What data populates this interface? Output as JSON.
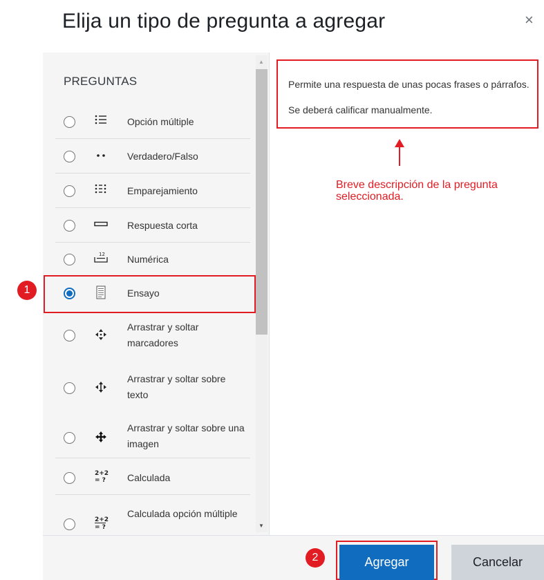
{
  "dialog": {
    "title": "Elija un tipo de pregunta a agregar",
    "close_symbol": "×"
  },
  "left_pane": {
    "section_label": "PREGUNTAS",
    "items": [
      {
        "name": "opcion-multiple",
        "label": "Opción múltiple",
        "icon": "list-icon",
        "glyph": "⁝☰",
        "checked": false
      },
      {
        "name": "verdadero-falso",
        "label": "Verdadero/Falso",
        "icon": "two-dots-icon",
        "glyph": "• •",
        "checked": false
      },
      {
        "name": "emparejamiento",
        "label": "Emparejamiento",
        "icon": "matching-icon",
        "glyph": "⁝⁝",
        "checked": false
      },
      {
        "name": "respuesta-corta",
        "label": "Respuesta corta",
        "icon": "short-answer-icon",
        "glyph": "▭",
        "checked": false
      },
      {
        "name": "numerica",
        "label": "Numérica",
        "icon": "numeric-icon",
        "glyph": "12",
        "checked": false
      },
      {
        "name": "ensayo",
        "label": "Ensayo",
        "icon": "essay-icon",
        "glyph": "▤",
        "checked": true
      },
      {
        "name": "arrastrar-marcadores",
        "label": "Arrastrar y soltar marcadores",
        "icon": "drag-markers-icon",
        "glyph": "✣",
        "checked": false
      },
      {
        "name": "arrastrar-texto",
        "label": "Arrastrar y soltar sobre texto",
        "icon": "drag-text-icon",
        "glyph": "✥",
        "checked": false
      },
      {
        "name": "arrastrar-imagen",
        "label": "Arrastrar y soltar sobre una imagen",
        "icon": "drag-image-icon",
        "glyph": "✚",
        "checked": false
      },
      {
        "name": "calculada",
        "label": "Calculada",
        "icon": "calculated-icon",
        "glyph": "2+2",
        "checked": false
      },
      {
        "name": "calculada-opcion-multiple",
        "label": "Calculada opción múltiple",
        "icon": "calculated-multi-icon",
        "glyph": "2+2",
        "checked": false
      }
    ]
  },
  "right_pane": {
    "description": "Permite una respuesta de unas pocas frases o párrafos. Se deberá calificar manualmente.",
    "annotation": "Breve descripción de la pregunta seleccionada."
  },
  "badges": {
    "step1": "1",
    "step2": "2"
  },
  "footer": {
    "add_label": "Agregar",
    "cancel_label": "Cancelar"
  },
  "colors": {
    "accent": "#0f6cbf",
    "annotation_red": "#e21c23",
    "pane_bg": "#f5f5f5",
    "cancel_bg": "#ced4da"
  }
}
